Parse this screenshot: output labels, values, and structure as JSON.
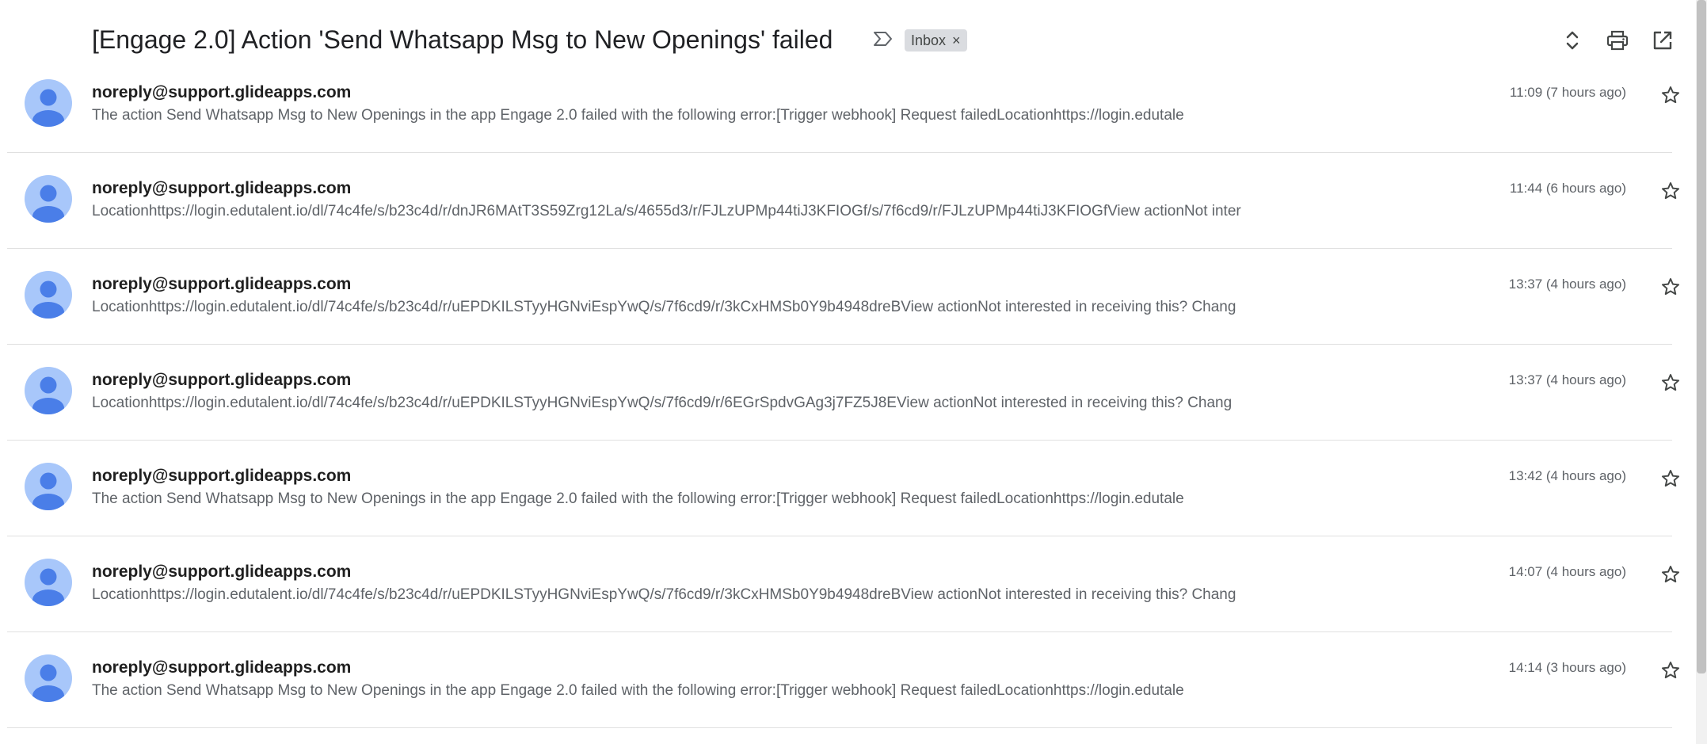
{
  "thread": {
    "subject": "[Engage 2.0] Action 'Send Whatsapp Msg to New Openings' failed",
    "label": "Inbox",
    "label_close": "×"
  },
  "header_icons": {
    "important": "important-marker-icon",
    "expand": "expand-collapse-icon",
    "print": "print-icon",
    "open_new_window": "open-in-new-window-icon"
  },
  "colors": {
    "avatar_bg": "#a8c7fa",
    "avatar_fg": "#5b8def",
    "label_chip_bg": "#dadce0"
  },
  "messages": [
    {
      "sender": "noreply@support.glideapps.com",
      "snippet": "The action Send Whatsapp Msg to New Openings in the app Engage 2.0 failed with the following error:[Trigger webhook] Request failedLocationhttps://login.edutale",
      "time": "11:09 (7 hours ago)"
    },
    {
      "sender": "noreply@support.glideapps.com",
      "snippet": "Locationhttps://login.edutalent.io/dl/74c4fe/s/b23c4d/r/dnJR6MAtT3S59Zrg12La/s/4655d3/r/FJLzUPMp44tiJ3KFIOGf/s/7f6cd9/r/FJLzUPMp44tiJ3KFIOGfView actionNot inter",
      "time": "11:44 (6 hours ago)"
    },
    {
      "sender": "noreply@support.glideapps.com",
      "snippet": "Locationhttps://login.edutalent.io/dl/74c4fe/s/b23c4d/r/uEPDKILSTyyHGNviEspYwQ/s/7f6cd9/r/3kCxHMSb0Y9b4948dreBView actionNot interested in receiving this? Chang",
      "time": "13:37 (4 hours ago)"
    },
    {
      "sender": "noreply@support.glideapps.com",
      "snippet": "Locationhttps://login.edutalent.io/dl/74c4fe/s/b23c4d/r/uEPDKILSTyyHGNviEspYwQ/s/7f6cd9/r/6EGrSpdvGAg3j7FZ5J8EView actionNot interested in receiving this? Chang",
      "time": "13:37 (4 hours ago)"
    },
    {
      "sender": "noreply@support.glideapps.com",
      "snippet": "The action Send Whatsapp Msg to New Openings in the app Engage 2.0 failed with the following error:[Trigger webhook] Request failedLocationhttps://login.edutale",
      "time": "13:42 (4 hours ago)"
    },
    {
      "sender": "noreply@support.glideapps.com",
      "snippet": "Locationhttps://login.edutalent.io/dl/74c4fe/s/b23c4d/r/uEPDKILSTyyHGNviEspYwQ/s/7f6cd9/r/3kCxHMSb0Y9b4948dreBView actionNot interested in receiving this? Chang",
      "time": "14:07 (4 hours ago)"
    },
    {
      "sender": "noreply@support.glideapps.com",
      "snippet": "The action Send Whatsapp Msg to New Openings in the app Engage 2.0 failed with the following error:[Trigger webhook] Request failedLocationhttps://login.edutale",
      "time": "14:14 (3 hours ago)"
    }
  ]
}
